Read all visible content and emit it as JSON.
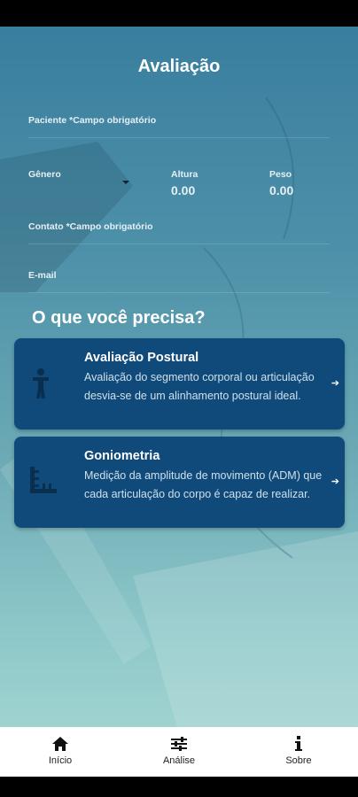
{
  "header": {
    "title": "Avaliação"
  },
  "form": {
    "patient_label": "Paciente *Campo obrigatório",
    "gender_label": "Gênero",
    "height_label": "Altura",
    "height_value": "0.00",
    "weight_label": "Peso",
    "weight_value": "0.00",
    "contact_label": "Contato *Campo obrigatório",
    "email_label": "E-mail"
  },
  "section": {
    "title": "O que você precisa?"
  },
  "cards": [
    {
      "title": "Avaliação Postural",
      "description": "Avaliação do segmento corporal ou articulação desvia-se de um alinhamento postural ideal.",
      "icon": "person-icon"
    },
    {
      "title": "Goniometria",
      "description": "Medição da amplitude de movimento (ADM) que cada articulação do corpo é capaz de realizar.",
      "icon": "goniometer-icon"
    }
  ],
  "nav": {
    "items": [
      {
        "label": "Início",
        "icon": "home-icon"
      },
      {
        "label": "Análise",
        "icon": "sliders-icon"
      },
      {
        "label": "Sobre",
        "icon": "info-icon"
      }
    ]
  },
  "colors": {
    "card_bg": "#0f4a7a",
    "accent": "#3a7e9f"
  }
}
